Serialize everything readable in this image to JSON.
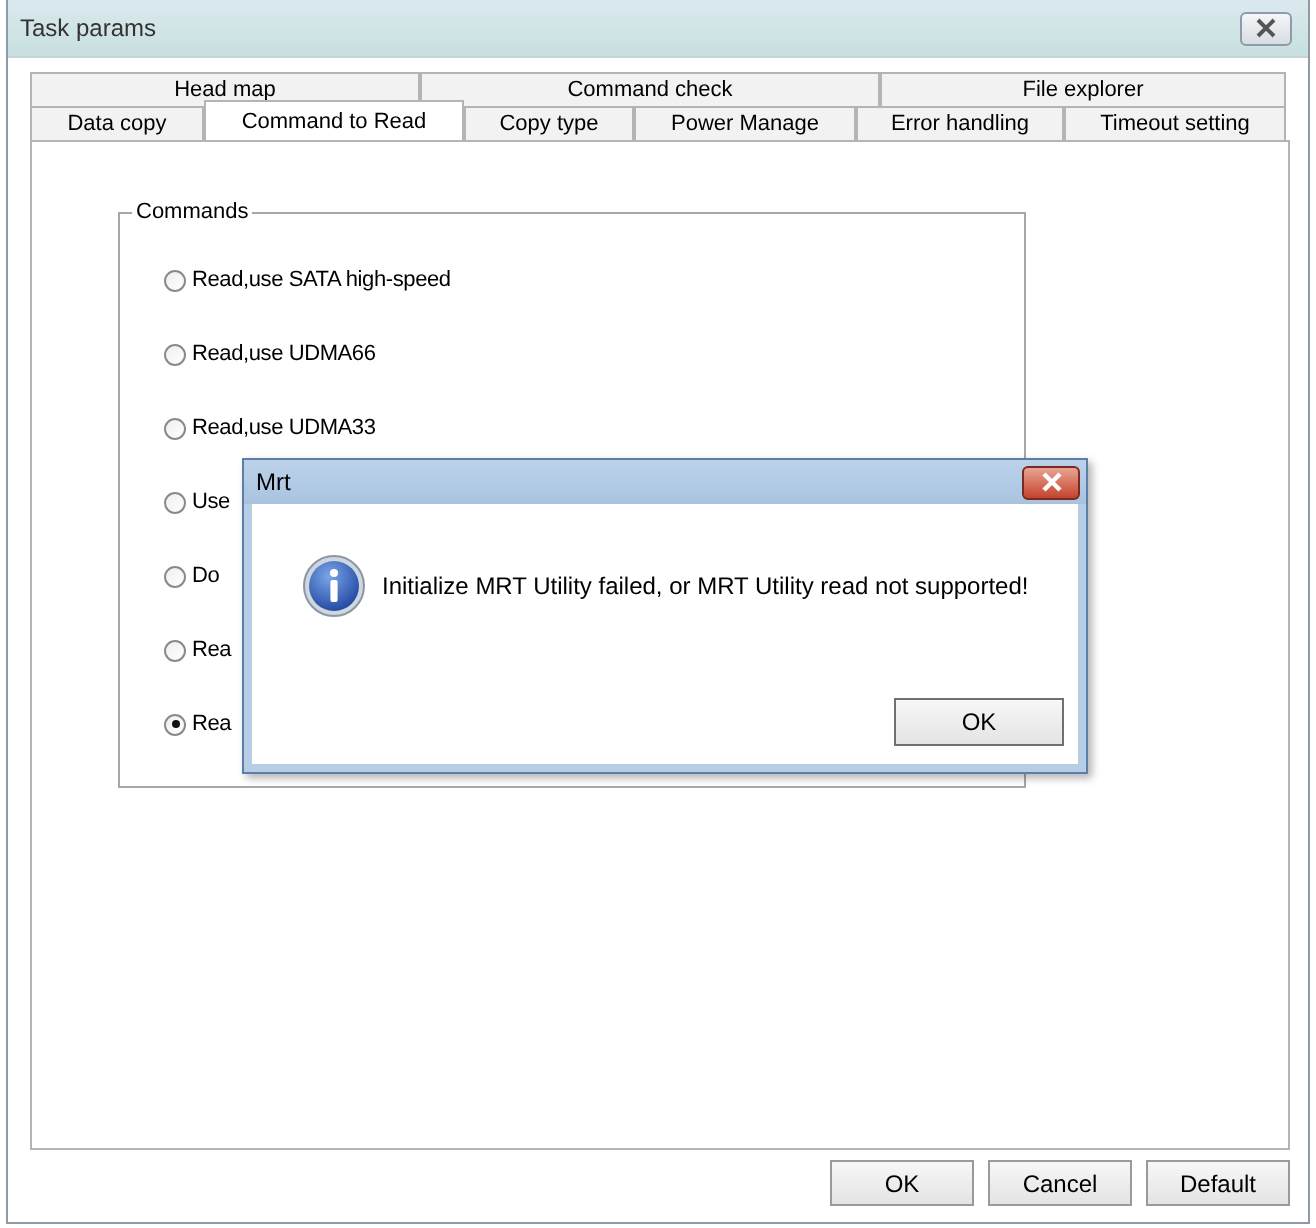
{
  "window": {
    "title": "Task params"
  },
  "tab_rows": [
    [
      {
        "label": "Head map",
        "selected": false
      },
      {
        "label": "Command check",
        "selected": false
      },
      {
        "label": "File explorer",
        "selected": false
      }
    ],
    [
      {
        "label": "Data copy",
        "selected": false
      },
      {
        "label": "Command to Read",
        "selected": true
      },
      {
        "label": "Copy type",
        "selected": false
      },
      {
        "label": "Power Manage",
        "selected": false
      },
      {
        "label": "Error handling",
        "selected": false
      },
      {
        "label": "Timeout setting",
        "selected": false
      }
    ]
  ],
  "commands": {
    "title": "Commands",
    "options": [
      {
        "label": "Read,use SATA high-speed",
        "selected": false
      },
      {
        "label": "Read,use UDMA66",
        "selected": false
      },
      {
        "label": "Read,use UDMA33",
        "selected": false
      },
      {
        "label": "Use",
        "selected": false
      },
      {
        "label": "Do",
        "selected": false
      },
      {
        "label": "Rea",
        "selected": false
      },
      {
        "label": "Rea",
        "selected": true
      }
    ]
  },
  "buttons": [
    "OK",
    "Cancel",
    "Default"
  ],
  "dialog": {
    "title": "Mrt",
    "message": "Initialize MRT Utility failed, or MRT Utility read not supported!",
    "button": "OK"
  }
}
